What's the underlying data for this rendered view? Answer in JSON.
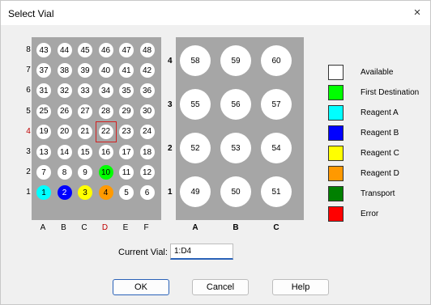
{
  "dialog": {
    "title": "Select Vial",
    "close_label": "×"
  },
  "small_rack": {
    "row_labels": [
      {
        "label": "8",
        "color": "#000000"
      },
      {
        "label": "7",
        "color": "#000000"
      },
      {
        "label": "6",
        "color": "#000000"
      },
      {
        "label": "5",
        "color": "#000000"
      },
      {
        "label": "4",
        "color": "#c00000"
      },
      {
        "label": "3",
        "color": "#000000"
      },
      {
        "label": "2",
        "color": "#000000"
      },
      {
        "label": "1",
        "color": "#000000"
      }
    ],
    "col_labels": [
      {
        "label": "A",
        "color": "#000000"
      },
      {
        "label": "B",
        "color": "#000000"
      },
      {
        "label": "C",
        "color": "#000000"
      },
      {
        "label": "D",
        "color": "#c00000"
      },
      {
        "label": "E",
        "color": "#000000"
      },
      {
        "label": "F",
        "color": "#000000"
      }
    ],
    "rows": [
      [
        {
          "n": "43",
          "s": "available"
        },
        {
          "n": "44",
          "s": "available"
        },
        {
          "n": "45",
          "s": "available"
        },
        {
          "n": "46",
          "s": "available"
        },
        {
          "n": "47",
          "s": "available"
        },
        {
          "n": "48",
          "s": "available"
        }
      ],
      [
        {
          "n": "37",
          "s": "available"
        },
        {
          "n": "38",
          "s": "available"
        },
        {
          "n": "39",
          "s": "available"
        },
        {
          "n": "40",
          "s": "available"
        },
        {
          "n": "41",
          "s": "available"
        },
        {
          "n": "42",
          "s": "available"
        }
      ],
      [
        {
          "n": "31",
          "s": "available"
        },
        {
          "n": "32",
          "s": "available"
        },
        {
          "n": "33",
          "s": "available"
        },
        {
          "n": "34",
          "s": "available"
        },
        {
          "n": "35",
          "s": "available"
        },
        {
          "n": "36",
          "s": "available"
        }
      ],
      [
        {
          "n": "25",
          "s": "available"
        },
        {
          "n": "26",
          "s": "available"
        },
        {
          "n": "27",
          "s": "available"
        },
        {
          "n": "28",
          "s": "available"
        },
        {
          "n": "29",
          "s": "available"
        },
        {
          "n": "30",
          "s": "available"
        }
      ],
      [
        {
          "n": "19",
          "s": "available"
        },
        {
          "n": "20",
          "s": "available"
        },
        {
          "n": "21",
          "s": "available"
        },
        {
          "n": "22",
          "s": "available",
          "selected": true
        },
        {
          "n": "23",
          "s": "available"
        },
        {
          "n": "24",
          "s": "available"
        }
      ],
      [
        {
          "n": "13",
          "s": "available"
        },
        {
          "n": "14",
          "s": "available"
        },
        {
          "n": "15",
          "s": "available"
        },
        {
          "n": "16",
          "s": "available"
        },
        {
          "n": "17",
          "s": "available"
        },
        {
          "n": "18",
          "s": "available"
        }
      ],
      [
        {
          "n": "7",
          "s": "available"
        },
        {
          "n": "8",
          "s": "available"
        },
        {
          "n": "9",
          "s": "available"
        },
        {
          "n": "10",
          "s": "first_destination"
        },
        {
          "n": "11",
          "s": "available"
        },
        {
          "n": "12",
          "s": "available"
        }
      ],
      [
        {
          "n": "1",
          "s": "reagent_a"
        },
        {
          "n": "2",
          "s": "reagent_b"
        },
        {
          "n": "3",
          "s": "reagent_c"
        },
        {
          "n": "4",
          "s": "reagent_d"
        },
        {
          "n": "5",
          "s": "available"
        },
        {
          "n": "6",
          "s": "available"
        }
      ]
    ]
  },
  "large_rack": {
    "row_labels": [
      "4",
      "3",
      "2",
      "1"
    ],
    "col_labels": [
      "A",
      "B",
      "C"
    ],
    "rows": [
      [
        {
          "n": "58",
          "s": "available"
        },
        {
          "n": "59",
          "s": "available"
        },
        {
          "n": "60",
          "s": "available"
        }
      ],
      [
        {
          "n": "55",
          "s": "available"
        },
        {
          "n": "56",
          "s": "available"
        },
        {
          "n": "57",
          "s": "available"
        }
      ],
      [
        {
          "n": "52",
          "s": "available"
        },
        {
          "n": "53",
          "s": "available"
        },
        {
          "n": "54",
          "s": "available"
        }
      ],
      [
        {
          "n": "49",
          "s": "available"
        },
        {
          "n": "50",
          "s": "available"
        },
        {
          "n": "51",
          "s": "available"
        }
      ]
    ]
  },
  "status_colors": {
    "available": "#ffffff",
    "first_destination": "#00ff00",
    "reagent_a": "#00ffff",
    "reagent_b": "#0000ff",
    "reagent_c": "#ffff00",
    "reagent_d": "#ff9900",
    "transport": "#008000",
    "error": "#ff0000"
  },
  "legend": [
    {
      "label": "Available",
      "color": "#ffffff"
    },
    {
      "label": "First Destination",
      "color": "#00ff00"
    },
    {
      "label": "Reagent A",
      "color": "#00ffff"
    },
    {
      "label": "Reagent B",
      "color": "#0000ff"
    },
    {
      "label": "Reagent C",
      "color": "#ffff00"
    },
    {
      "label": "Reagent D",
      "color": "#ff9900"
    },
    {
      "label": "Transport",
      "color": "#008000"
    },
    {
      "label": "Error",
      "color": "#ff0000"
    }
  ],
  "current_vial": {
    "label": "Current Vial:",
    "value": "1:D4"
  },
  "buttons": {
    "ok": "OK",
    "cancel": "Cancel",
    "help": "Help"
  }
}
